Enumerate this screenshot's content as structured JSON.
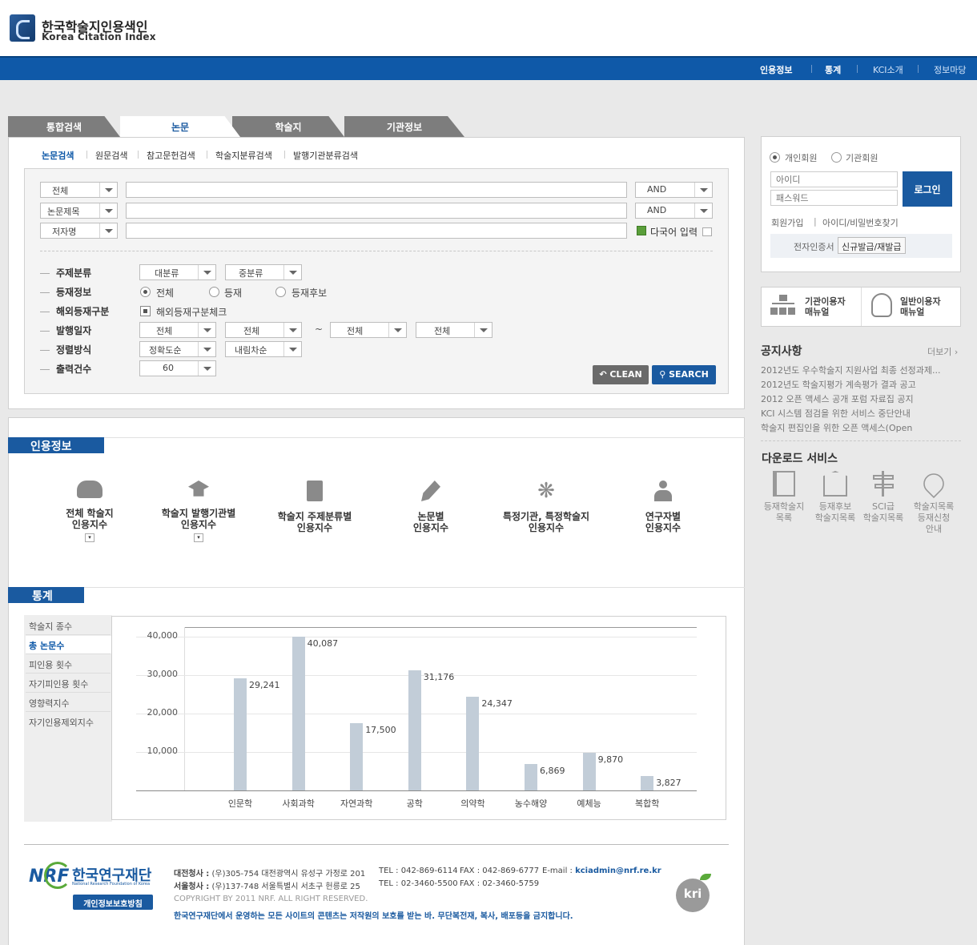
{
  "logo": {
    "title_ko": "한국학술지인용색인",
    "title_en": "Korea Citation Index"
  },
  "top_nav": [
    {
      "label": "인용정보",
      "bold": true
    },
    {
      "label": "통계",
      "bold": true
    },
    {
      "label": "KCI소개",
      "bold": false
    },
    {
      "label": "정보마당",
      "bold": false
    }
  ],
  "main_tabs": [
    "통합검색",
    "논문",
    "학술지",
    "기관정보"
  ],
  "active_tab": "논문",
  "sub_tabs": [
    "논문검색",
    "원문검색",
    "참고문헌검색",
    "학술지분류검색",
    "발행기관분류검색"
  ],
  "search": {
    "rows": [
      {
        "field": "전체",
        "op": "AND",
        "value": ""
      },
      {
        "field": "논문제목",
        "op": "AND",
        "value": ""
      },
      {
        "field": "저자명",
        "op": "",
        "value": ""
      }
    ],
    "multilang_label": "다국어 입력",
    "labels": {
      "subject": "주제분류",
      "publish_info": "등재정보",
      "overseas": "해외등재구분",
      "pub_date": "발행일자",
      "sort": "정렬방식",
      "output_count": "출력건수"
    },
    "subject_major": "대분류",
    "subject_middle": "중분류",
    "publish_options": [
      "전체",
      "등재",
      "등재후보"
    ],
    "publish_selected": "전체",
    "overseas_check": "해외등재구분체크",
    "date_from_year": "전체",
    "date_from_month": "전체",
    "date_tilde": "~",
    "date_to_year": "전체",
    "date_to_month": "전체",
    "sort_by": "정확도순",
    "sort_order": "내림차순",
    "output_count": "60",
    "clean_label": "CLEAN",
    "search_label": "SEARCH"
  },
  "login": {
    "member_types": [
      "개인회원",
      "기관회원"
    ],
    "selected": "개인회원",
    "id_placeholder": "아이디",
    "pw_placeholder": "패스워드",
    "login_button": "로그인",
    "join": "회원가입",
    "separator": "|",
    "find": "아이디/비밀번호찾기",
    "cert_label": "전자인증서",
    "cert_button": "신규발급/재발급"
  },
  "manuals": [
    {
      "label_line1": "기관이용자",
      "label_line2": "매뉴얼"
    },
    {
      "label_line1": "일반이용자",
      "label_line2": "매뉴얼"
    }
  ],
  "notice": {
    "title": "공지사항",
    "more": "더보기",
    "items": [
      "2012년도 우수학술지 지원사업 최종 선정과제...",
      "2012년도 학술지평가 계속평가 결과 공고",
      "2012 오픈 액세스 공개 포럼 자료집 공지",
      "KCI 시스템 점검을 위한 서비스 중단안내",
      "학술지 편집인을 위한 오픈 액세스(Open"
    ]
  },
  "downloads": {
    "title": "다운로드 서비스",
    "items": [
      {
        "lines": [
          "등재학술지",
          "목록"
        ]
      },
      {
        "lines": [
          "등재후보",
          "학술지목록"
        ]
      },
      {
        "lines": [
          "SCI급",
          "학술지목록"
        ]
      },
      {
        "lines": [
          "학술지목록",
          "등재신청",
          "안내"
        ]
      }
    ]
  },
  "citation_info": {
    "title": "인용정보",
    "items": [
      {
        "line1": "전체 학술지",
        "line2": "인용지수",
        "icon": "cloud-icon",
        "has_dropdown": true
      },
      {
        "line1": "학술지 발행기관별",
        "line2": "인용지수",
        "icon": "graduation-cap-icon",
        "has_dropdown": true
      },
      {
        "line1": "학술지 주제분류별",
        "line2": "인용지수",
        "icon": "book-icon",
        "has_dropdown": false
      },
      {
        "line1": "논문별",
        "line2": "인용지수",
        "icon": "pen-icon",
        "has_dropdown": false
      },
      {
        "line1": "특정기관, 특정학술지",
        "line2": "인용지수",
        "icon": "flower-icon",
        "has_dropdown": false
      },
      {
        "line1": "연구자별",
        "line2": "인용지수",
        "icon": "person-icon",
        "has_dropdown": false
      }
    ]
  },
  "stats": {
    "title": "통계",
    "menu": [
      "학술지 종수",
      "총 논문수",
      "피인용 횟수",
      "자기피인용 횟수",
      "영향력지수",
      "자기인용제외지수"
    ],
    "active_menu": "총 논문수"
  },
  "chart_data": {
    "type": "bar",
    "title": "",
    "xlabel": "",
    "ylabel": "",
    "categories": [
      "인문학",
      "사회과학",
      "자연과학",
      "공학",
      "의약학",
      "농수해양",
      "예체능",
      "복합학"
    ],
    "values": [
      29241,
      40087,
      17500,
      31176,
      24347,
      6869,
      9870,
      3827
    ],
    "value_labels": [
      "29,241",
      "40,087",
      "17,500",
      "31,176",
      "24,347",
      "6,869",
      "9,870",
      "3,827"
    ],
    "yticks": [
      "10,000",
      "20,000",
      "30,000",
      "40,000"
    ],
    "ytick_values": [
      10000,
      20000,
      30000,
      40000
    ],
    "ylim": [
      0,
      42000
    ],
    "grid": true,
    "bar_color": "#c2cdd8"
  },
  "footer": {
    "org_name": "한국연구재단",
    "org_en": "National Research Foundation of Korea",
    "org_abbr": "NRF",
    "privacy": "개인정보보호방침",
    "daejeon_label": "대전청사 :",
    "daejeon_addr": "(우)305-754 대전광역시 유성구 가정로 201",
    "daejeon_tel": "TEL : 042-869-6114",
    "daejeon_fax": "FAX : 042-869-6777",
    "email_label": "E-mail :",
    "email": "kciadmin@nrf.re.kr",
    "seoul_label": "서울청사 :",
    "seoul_addr": "(우)137-748 서울특별시 서초구 헌릉로 25",
    "seoul_tel": "TEL : 02-3460-5500",
    "seoul_fax": "FAX : 02-3460-5759",
    "copyright": "COPYRIGHT BY 2011 NRF. ALL RIGHT RESERVED.",
    "notice": "한국연구재단에서 운영하는 모든 사이트의 콘텐츠는 저작원의 보호를 받는 바. 무단복전재, 복사, 배포등을 금지합니다.",
    "kri": "kri"
  }
}
